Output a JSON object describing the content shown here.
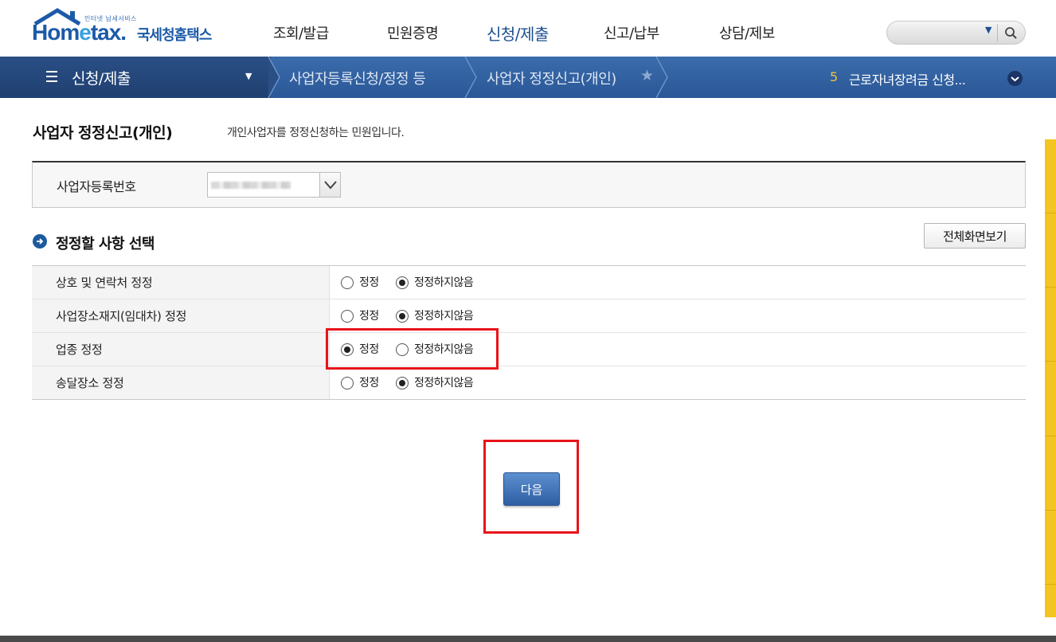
{
  "header": {
    "logo_tagline": "인터넷 납세서비스",
    "logo_brand_pre": "Hom",
    "logo_brand_e": "e",
    "logo_brand_post": "tax.",
    "logo_korean": "국세청홈택스",
    "nav": [
      "조회/발급",
      "민원증명",
      "신청/제출",
      "신고/납부",
      "상담/제보"
    ],
    "active_nav_index": 2,
    "search": {
      "value": ""
    }
  },
  "breadcrumb": {
    "main": "신청/제출",
    "sub1": "사업자등록신청/정정 등",
    "sub2": "사업자 정정신고(개인)",
    "news_number": "5",
    "news_text": "근로자녀장려금 신청..."
  },
  "page": {
    "title": "사업자 정정신고(개인)",
    "description": "개인사업자를 정정신청하는 민원입니다.",
    "registration_label": "사업자등록번호",
    "section_title": "정정할 사항 선택",
    "fullscreen_label": "전체화면보기",
    "options": [
      {
        "label": "상호 및 연락처 정정",
        "opt1": "정정",
        "opt2": "정정하지않음",
        "selected": "opt2"
      },
      {
        "label": "사업장소재지(임대차) 정정",
        "opt1": "정정",
        "opt2": "정정하지않음",
        "selected": "opt2"
      },
      {
        "label": "업종 정정",
        "opt1": "정정",
        "opt2": "정정하지않음",
        "selected": "opt1"
      },
      {
        "label": "송달장소 정정",
        "opt1": "정정",
        "opt2": "정정하지않음",
        "selected": "opt2"
      }
    ],
    "next_label": "다음"
  },
  "colors": {
    "brand_blue": "#1b5aa8",
    "highlight_red": "#e8141a",
    "side_yellow": "#f4c521"
  }
}
